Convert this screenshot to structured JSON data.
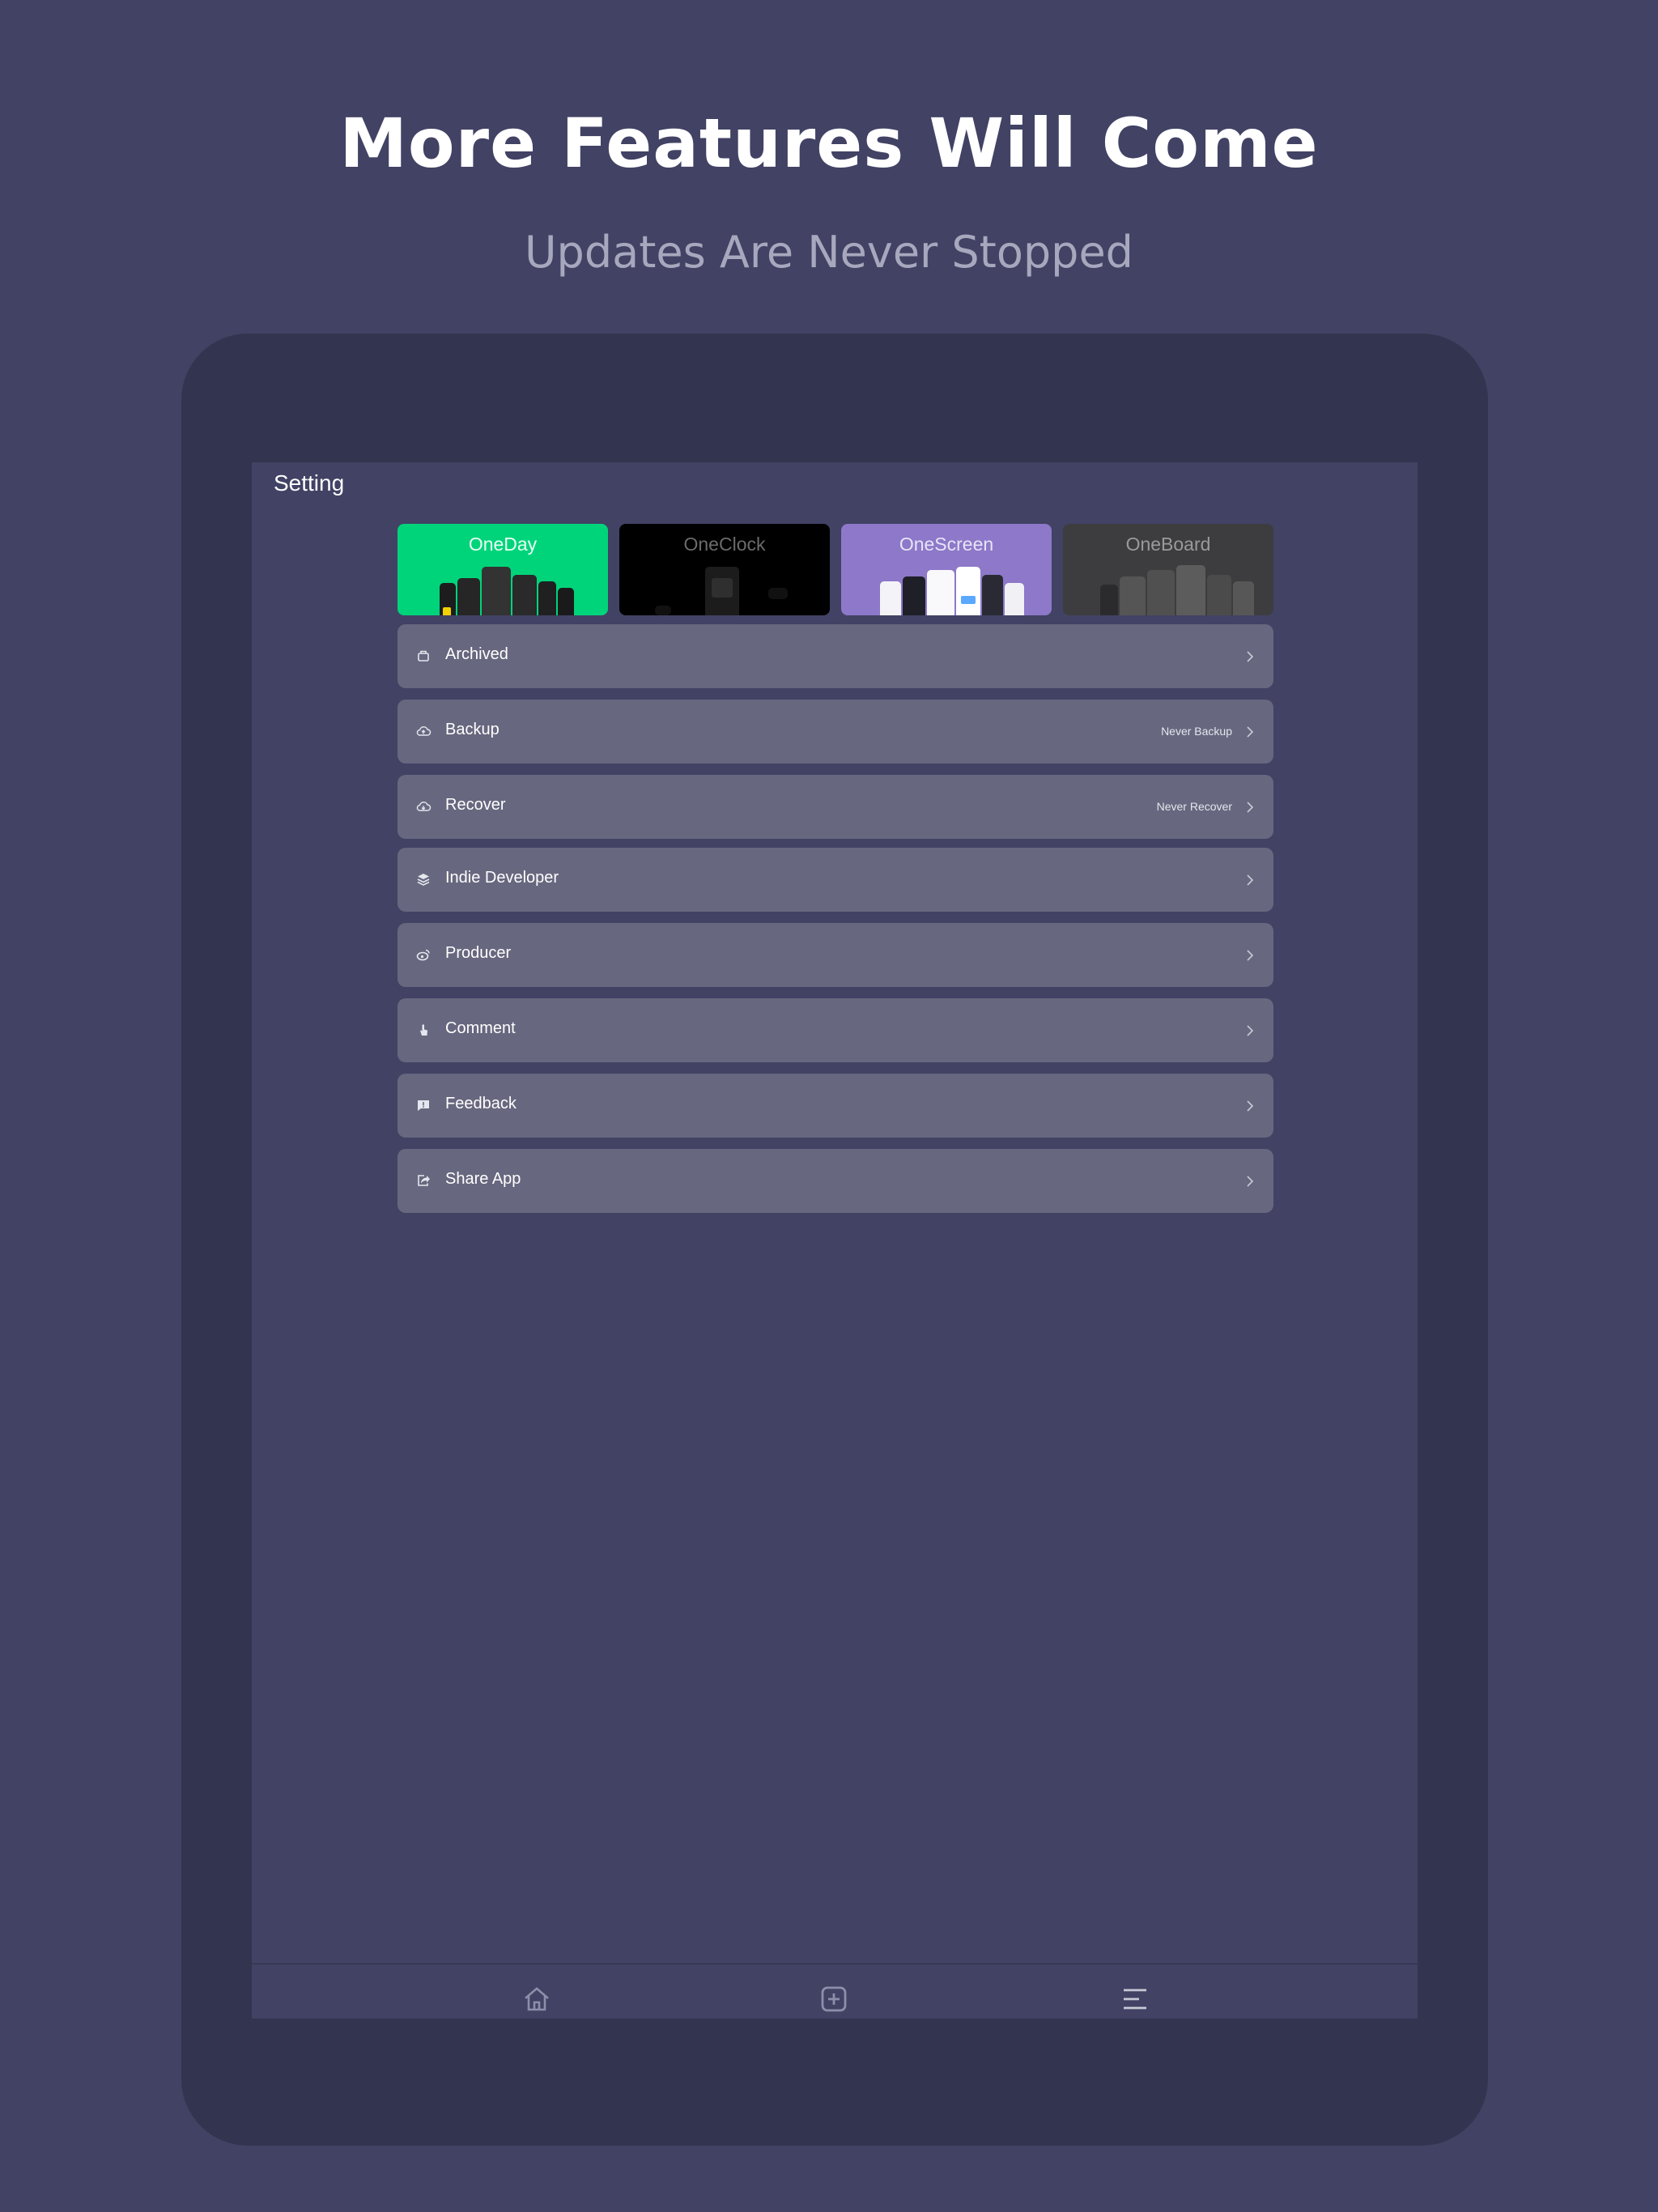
{
  "promo": {
    "headline": "More Features Will Come",
    "subheadline": "Updates Are Never Stopped"
  },
  "screen": {
    "title": "Setting"
  },
  "apps": [
    {
      "name": "OneDay",
      "bg": "#00d47b",
      "fg": "#ffffff"
    },
    {
      "name": "OneClock",
      "bg": "#000000",
      "fg": "#6b6b6b"
    },
    {
      "name": "OneScreen",
      "bg": "#8d78c9",
      "fg": "#e8e3f6"
    },
    {
      "name": "OneBoard",
      "bg": "#3d3d3f",
      "fg": "#9a9a9a"
    }
  ],
  "menu": [
    {
      "label": "Archived",
      "icon": "archive-icon",
      "status": ""
    },
    {
      "label": "Backup",
      "icon": "cloud-upload-icon",
      "status": "Never Backup"
    },
    {
      "label": "Recover",
      "icon": "cloud-download-icon",
      "status": "Never Recover"
    },
    {
      "label": "Indie Developer",
      "icon": "layers-icon",
      "status": ""
    },
    {
      "label": "Producer",
      "icon": "weibo-icon",
      "status": ""
    },
    {
      "label": "Comment",
      "icon": "hand-pointer-icon",
      "status": ""
    },
    {
      "label": "Feedback",
      "icon": "feedback-icon",
      "status": ""
    },
    {
      "label": "Share App",
      "icon": "share-icon",
      "status": ""
    }
  ],
  "tabbar": {
    "tabs": [
      "home-icon",
      "add-square-icon",
      "menu-icon"
    ]
  },
  "colors": {
    "background": "#414264",
    "device": "#33344f",
    "row": "#67677f"
  }
}
